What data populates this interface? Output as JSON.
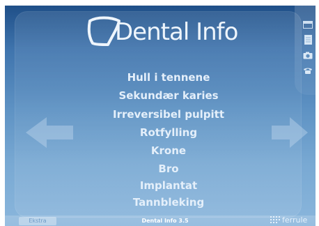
{
  "app": {
    "title": "Dental Info"
  },
  "menu": {
    "items": [
      "Hull i tennene",
      "Sekundær karies",
      "Irreversibel pulpitt",
      "Rotfylling",
      "Krone",
      "Bro",
      "Implantat",
      "Tannbleking"
    ]
  },
  "nav": {
    "prev_icon": "arrow-left-icon",
    "next_icon": "arrow-right-icon"
  },
  "side_icons": [
    "window-icon",
    "document-icon",
    "camera-icon",
    "phone-icon"
  ],
  "footer": {
    "extra_label": "Ekstra",
    "version_label": "Dental Info 3.5",
    "brand": "ferrule"
  },
  "colors": {
    "background_top": "#1f4f88",
    "background_bottom": "#8ab6dc",
    "text": "#e4effa"
  }
}
